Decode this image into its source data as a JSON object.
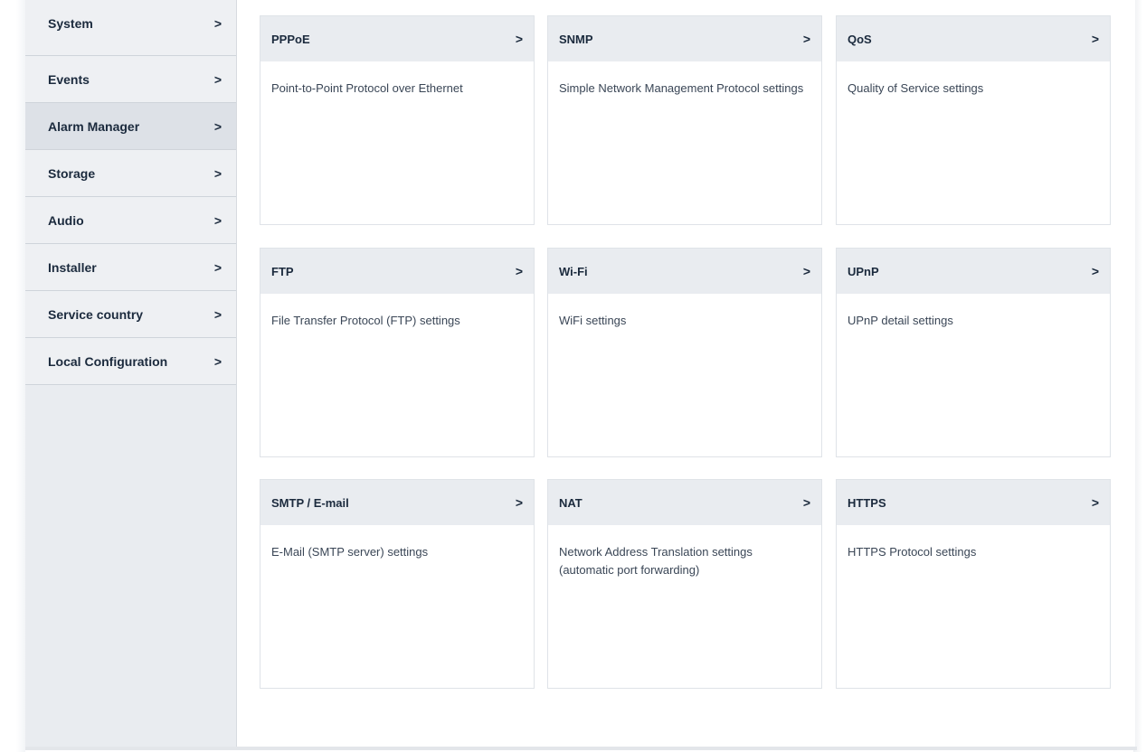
{
  "sidebar": {
    "items": [
      {
        "label": "System",
        "chevron": ">"
      },
      {
        "label": "Events",
        "chevron": ">"
      },
      {
        "label": "Alarm Manager",
        "chevron": ">"
      },
      {
        "label": "Storage",
        "chevron": ">"
      },
      {
        "label": "Audio",
        "chevron": ">"
      },
      {
        "label": "Installer",
        "chevron": ">"
      },
      {
        "label": "Service country",
        "chevron": ">"
      },
      {
        "label": "Local Configuration",
        "chevron": ">"
      }
    ],
    "active_index": 2
  },
  "cards": [
    {
      "title": "PPPoE",
      "chevron": ">",
      "description": "Point-to-Point Protocol over Ethernet"
    },
    {
      "title": "SNMP",
      "chevron": ">",
      "description": "Simple Network Management Protocol settings"
    },
    {
      "title": "QoS",
      "chevron": ">",
      "description": "Quality of Service settings"
    },
    {
      "title": "FTP",
      "chevron": ">",
      "description": "File Transfer Protocol (FTP) settings"
    },
    {
      "title": "Wi-Fi",
      "chevron": ">",
      "description": "WiFi settings"
    },
    {
      "title": "UPnP",
      "chevron": ">",
      "description": "UPnP detail settings"
    },
    {
      "title": "SMTP / E-mail",
      "chevron": ">",
      "description": "E-Mail (SMTP server) settings"
    },
    {
      "title": "NAT",
      "chevron": ">",
      "description": "Network Address Translation settings (automatic port forwarding)"
    },
    {
      "title": "HTTPS",
      "chevron": ">",
      "description": "HTTPS Protocol settings"
    }
  ],
  "colors": {
    "sidebar_bg": "#eef0f3",
    "sidebar_active_bg": "#dde1e7",
    "card_header_bg": "#e9ecf0",
    "text_dark": "#1b2a3d",
    "text_body": "#3a4656"
  }
}
